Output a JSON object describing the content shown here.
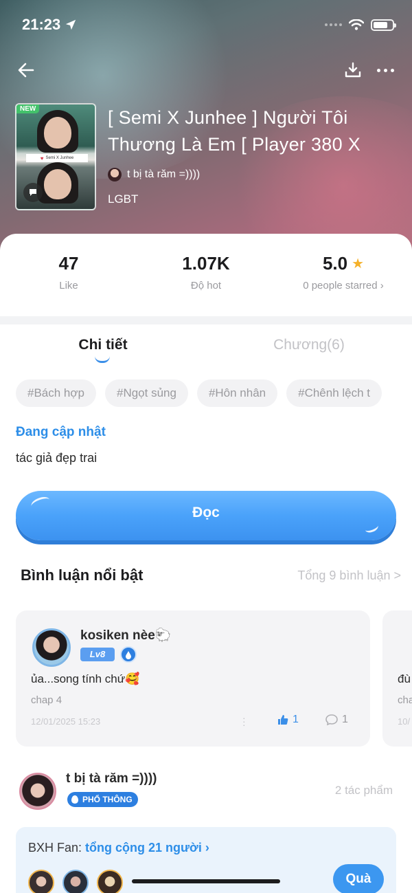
{
  "status_bar": {
    "time": "21:23"
  },
  "book": {
    "badge": "NEW",
    "cover_caption": "Semi X Junhee",
    "title": "[ Semi X Junhee ] Người Tôi Thương Là Em [ Player 380 X",
    "author": "t bị tà răm =))))",
    "genre": "LGBT"
  },
  "stats": [
    {
      "value": "47",
      "label": "Like"
    },
    {
      "value": "1.07K",
      "label": "Độ hot"
    },
    {
      "value": "5.0",
      "label": "0 people starred ›"
    }
  ],
  "tabs": [
    {
      "label": "Chi tiết",
      "active": true
    },
    {
      "label": "Chương(6)",
      "active": false
    }
  ],
  "tags": [
    "#Bách hợp",
    "#Ngọt sủng",
    "#Hôn nhân",
    "#Chênh lệch t"
  ],
  "update_status": "Đang cập nhật",
  "description": "tác giả đẹp trai",
  "read_button": "Đọc",
  "comments_section": {
    "title": "Bình luận nổi bật",
    "total": "Tổng 9 bình luận >",
    "comments": [
      {
        "user": "kosiken nèe🐑",
        "level": "Lv8",
        "text": "ủa...song tính chứ🥰",
        "sub": "chap 4",
        "date": "12/01/2025 15:23",
        "likes": "1",
        "replies": "1"
      }
    ],
    "peek": {
      "text": "đù",
      "sub": "cha",
      "date": "10/"
    }
  },
  "author_section": {
    "name": "t bị tà răm =))))",
    "badge": "PHỔ THÔNG",
    "works": "2 tác phẩm"
  },
  "fan_rank": {
    "label": "BXH Fan: ",
    "count": "tổng cộng 21 người ›",
    "button": "Quà"
  },
  "colors": {
    "accent": "#3b8fe8",
    "star": "#f5b12a",
    "new_badge": "#43c26b"
  }
}
